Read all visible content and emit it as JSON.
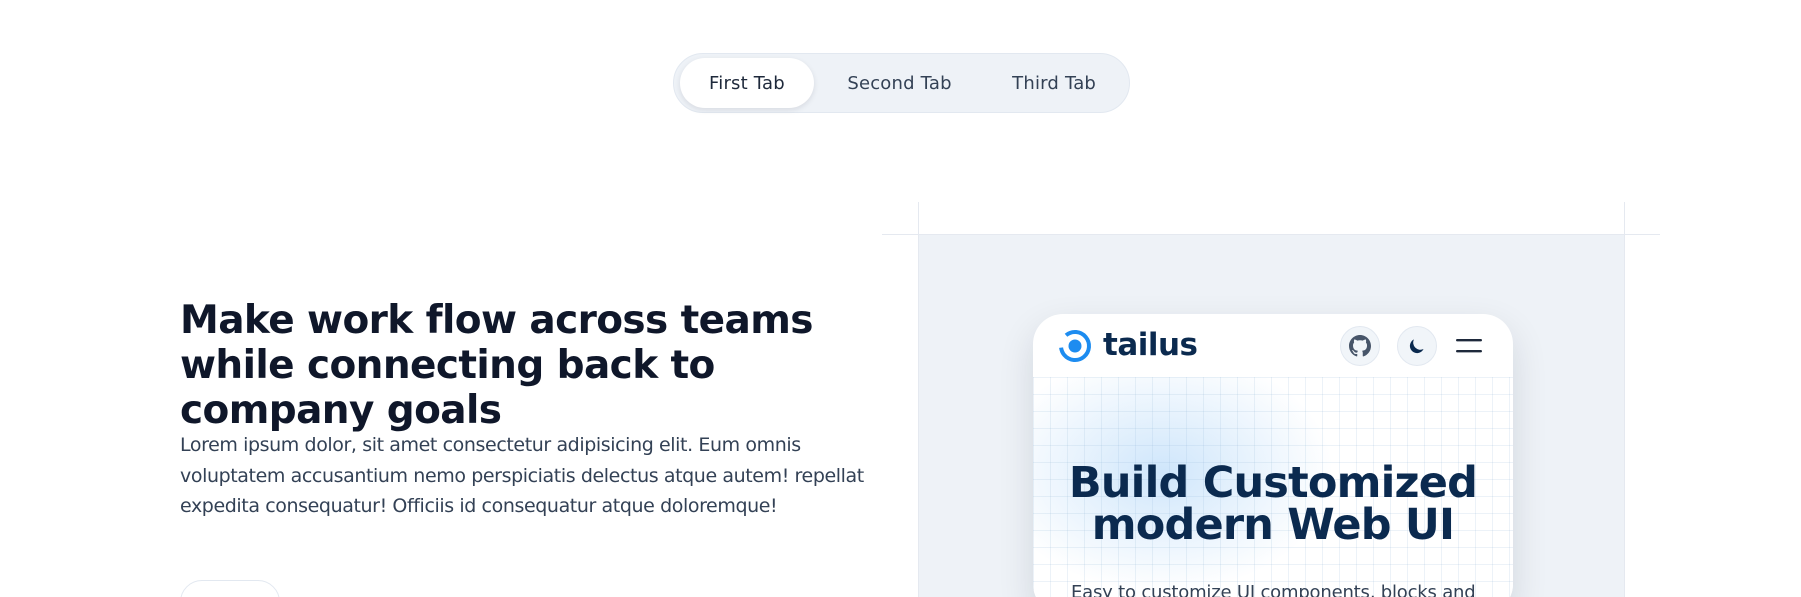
{
  "tabs": [
    {
      "label": "First Tab",
      "active": true
    },
    {
      "label": "Second Tab",
      "active": false
    },
    {
      "label": "Third Tab",
      "active": false
    }
  ],
  "content": {
    "headline": "Make work flow across teams while connecting back to company goals",
    "paragraph": "Lorem ipsum dolor, sit amet consectetur adipisicing elit. Eum omnis voluptatem accusantium nemo perspiciatis delectus atque autem! repellat expedita consequatur! Officiis id consequatur atque doloremque!"
  },
  "preview": {
    "brand": "tailus",
    "hero_title": "Build Customized modern Web UI",
    "hero_subtitle": "Easy to customize UI components, blocks and",
    "icons": [
      "logo-icon",
      "github-icon",
      "moon-icon",
      "menu-icon"
    ]
  },
  "colors": {
    "brand_blue": "#0b2a4f",
    "logo_blue": "#1d8cf0",
    "panel_bg": "#eef2f7",
    "tab_bg": "#eef2f7"
  }
}
